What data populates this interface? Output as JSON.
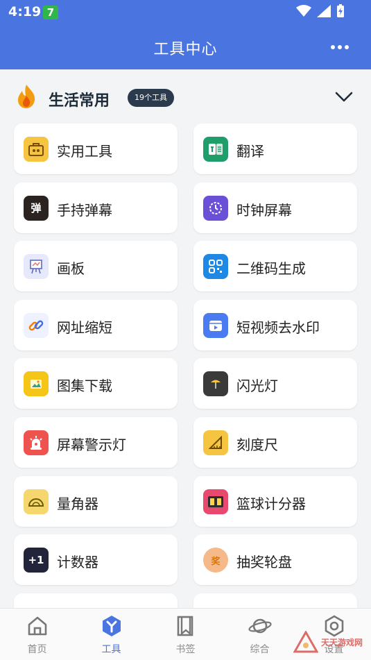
{
  "status": {
    "time": "4:19",
    "badge": "7"
  },
  "appbar": {
    "title": "工具中心"
  },
  "section": {
    "title": "生活常用",
    "count": "19个工具"
  },
  "tools": [
    {
      "label": "实用工具",
      "icon": "toolbox-icon",
      "color": "#f5c542"
    },
    {
      "label": "翻译",
      "icon": "translate-icon",
      "color": "#1f9d6a"
    },
    {
      "label": "手持弹幕",
      "icon": "danmaku-icon",
      "color": "#2b2320",
      "glyph": "弹"
    },
    {
      "label": "时钟屏幕",
      "icon": "clock-icon",
      "color": "#6b4fd6"
    },
    {
      "label": "画板",
      "icon": "easel-icon",
      "color": "#e6e8fb"
    },
    {
      "label": "二维码生成",
      "icon": "qrcode-icon",
      "color": "#1e88e5"
    },
    {
      "label": "网址缩短",
      "icon": "link-icon",
      "color": "#eef2ff"
    },
    {
      "label": "短视频去水印",
      "icon": "video-icon",
      "color": "#4a7bf0"
    },
    {
      "label": "图集下载",
      "icon": "gallery-icon",
      "color": "#f5c518"
    },
    {
      "label": "闪光灯",
      "icon": "flashlight-icon",
      "color": "#3a3a3a"
    },
    {
      "label": "屏幕警示灯",
      "icon": "alarm-light-icon",
      "color": "#ef5350"
    },
    {
      "label": "刻度尺",
      "icon": "ruler-icon",
      "color": "#f5c542"
    },
    {
      "label": "量角器",
      "icon": "protractor-icon",
      "color": "#f5d76e"
    },
    {
      "label": "篮球计分器",
      "icon": "scoreboard-icon",
      "color": "#e84a6f"
    },
    {
      "label": "计数器",
      "icon": "counter-icon",
      "color": "#22253a",
      "glyph": "+1"
    },
    {
      "label": "抽奖轮盘",
      "icon": "lottery-icon",
      "color": "#f5b98a",
      "glyph": "奖"
    }
  ],
  "nav": [
    {
      "label": "首页",
      "icon": "home-icon",
      "active": false
    },
    {
      "label": "工具",
      "icon": "tools-icon",
      "active": true
    },
    {
      "label": "书签",
      "icon": "bookmark-icon",
      "active": false
    },
    {
      "label": "综合",
      "icon": "planet-icon",
      "active": false
    },
    {
      "label": "设置",
      "icon": "settings-icon",
      "active": false
    }
  ],
  "watermark": {
    "text": "天天游戏网"
  },
  "colors": {
    "primary": "#4a74e0",
    "background": "#f3f4f6"
  }
}
